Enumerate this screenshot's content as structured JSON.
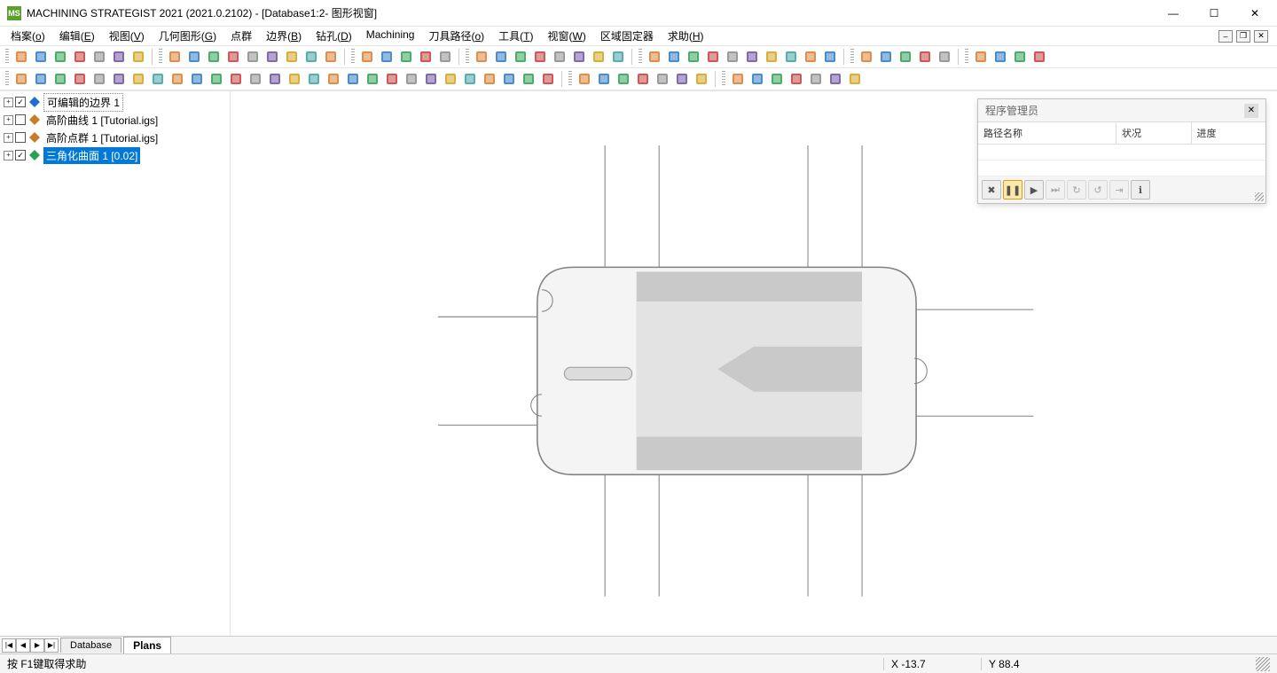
{
  "titlebar": {
    "app_icon_text": "MS",
    "title": "MACHINING STRATEGIST 2021 (2021.0.2102) - [Database1:2- 图形视窗]"
  },
  "window_controls": {
    "min": "—",
    "max": "☐",
    "close": "✕"
  },
  "menu": {
    "items": [
      {
        "label": "档案",
        "accel": "o"
      },
      {
        "label": "编辑",
        "accel": "E"
      },
      {
        "label": "视图",
        "accel": "V"
      },
      {
        "label": "几何图形",
        "accel": "G"
      },
      {
        "label": "点群",
        "accel": ""
      },
      {
        "label": "边界",
        "accel": "B"
      },
      {
        "label": "钻孔",
        "accel": "D"
      },
      {
        "label": "Machining",
        "accel": ""
      },
      {
        "label": "刀具路径",
        "accel": "o"
      },
      {
        "label": "工具",
        "accel": "T"
      },
      {
        "label": "视窗",
        "accel": "W"
      },
      {
        "label": "区域固定器",
        "accel": ""
      },
      {
        "label": "求助",
        "accel": "H"
      }
    ]
  },
  "mdi": {
    "min": "–",
    "restore": "❐",
    "close": "✕"
  },
  "tree": {
    "nodes": [
      {
        "id": "boundaries",
        "label": "可编辑的边界 1",
        "checked": true,
        "icon": "boundary-icon",
        "icon_color": "#1f6fd0",
        "boxed": true,
        "selected": false
      },
      {
        "id": "curves",
        "label": "高阶曲线 1 [Tutorial.igs]",
        "checked": false,
        "icon": "curve-icon",
        "icon_color": "#c87c2a",
        "boxed": false,
        "selected": false
      },
      {
        "id": "points",
        "label": "高阶点群 1 [Tutorial.igs]",
        "checked": false,
        "icon": "points-icon",
        "icon_color": "#c87c2a",
        "boxed": false,
        "selected": false
      },
      {
        "id": "triangulated",
        "label": "三角化曲面 1 [0.02]",
        "checked": true,
        "icon": "surface-icon",
        "icon_color": "#2aa050",
        "boxed": false,
        "selected": true
      }
    ]
  },
  "panel": {
    "title": "程序管理员",
    "columns": {
      "c1": "路径名称",
      "c2": "状况",
      "c3": "进度"
    }
  },
  "tabs": {
    "primary": "Database",
    "secondary": "Plans",
    "nav": {
      "first": "|◀",
      "prev": "◀",
      "next": "▶",
      "last": "▶|"
    }
  },
  "status": {
    "help": "按 F1键取得求助",
    "x_label": "X",
    "x_val": "-13.7",
    "y_label": "Y",
    "y_val": "88.4"
  },
  "toolbar1_icons": [
    "new-file",
    "open-file",
    "run",
    "save",
    "copy",
    "print",
    "undo-redo"
  ],
  "toolbar1b_icons": [
    "axis",
    "ab-tag",
    "ac-tag",
    "bc-tag",
    "grid-1",
    "cards",
    "layers",
    "rows",
    "swatch"
  ],
  "toolbar1c_icons": [
    "solid",
    "wire",
    "cube-hl",
    "grid-s",
    "note"
  ],
  "toolbar1d_icons": [
    "iso-1",
    "iso-2",
    "iso-3",
    "iso-4",
    "iso-5",
    "iso-6",
    "iso-7",
    "iso-8"
  ],
  "toolbar1e_icons": [
    "tag-1",
    "tag-2",
    "pin",
    "flag",
    "measure",
    "angle",
    "dist",
    "circle-m",
    "select",
    "filter"
  ],
  "toolbar1f_icons": [
    "dot",
    "dots-2",
    "dots-3",
    "dots-4",
    "grid-dots"
  ],
  "toolbar1g_icons": [
    "ring",
    "layer-a",
    "layer-b",
    "swirl"
  ],
  "toolbar2_icons": [
    "import",
    "export",
    "shell",
    "red-1",
    "red-2",
    "red-3",
    "red-4",
    "fold",
    "arrow-dn",
    "arrow-up",
    "orange-1",
    "red-5",
    "red-6",
    "red-7",
    "red-8",
    "red-9",
    "red-10",
    "red-11",
    "blue-1",
    "blue-2",
    "orange-2",
    "orange-3",
    "orange-4",
    "gray-1",
    "gray-2",
    "gray-3",
    "path",
    "gear"
  ],
  "toolbar2b_icons": [
    "drill-1",
    "drill-2",
    "drill-3",
    "drill-4",
    "drill-5",
    "drill-6",
    "drill-7"
  ],
  "toolbar2c_icons": [
    "tool-1",
    "tool-2",
    "tool-3",
    "tool-4",
    "list-1",
    "list-2",
    "list-3"
  ],
  "panel_buttons": [
    "delete",
    "pause",
    "play",
    "skip-1",
    "skip-2",
    "skip-3",
    "skip-4",
    "info"
  ]
}
